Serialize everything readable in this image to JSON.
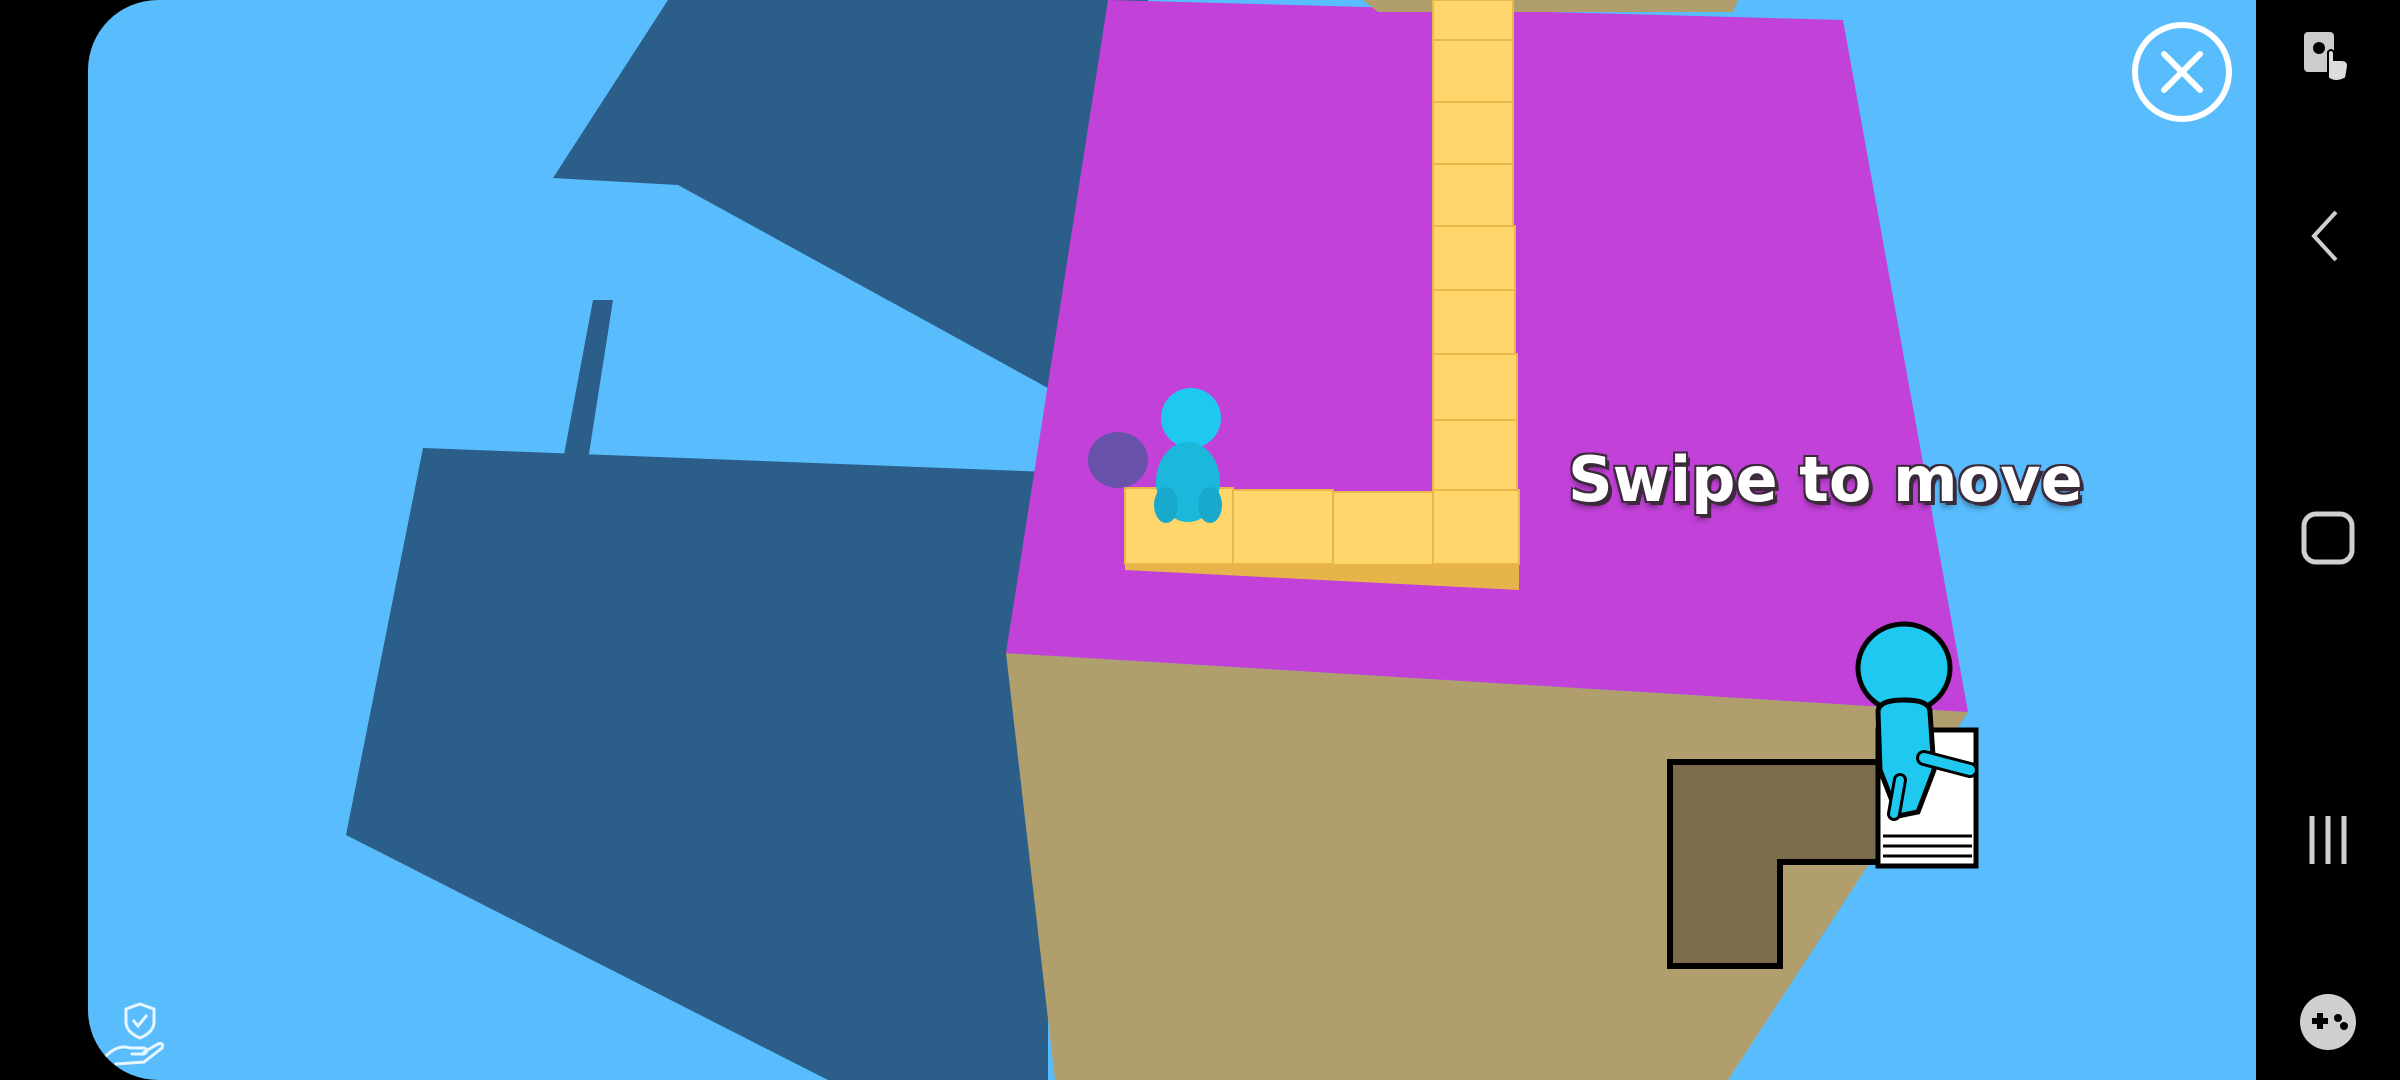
{
  "game": {
    "hint_text": "Swipe to move",
    "colors": {
      "sky": "#58BCFD",
      "shadow": "#2C5E8A",
      "platform_top": "#C241D8",
      "platform_side": "#B19E6D",
      "path_tile": "#FFD66B",
      "character": "#1EC8EE"
    }
  },
  "controls": {
    "close_icon": "close-icon",
    "ad_badge_icon": "shield-hand-icon"
  },
  "system_nav": {
    "items": [
      "screen-lock-touch-icon",
      "back-icon",
      "home-icon",
      "recents-icon",
      "game-tools-icon"
    ]
  }
}
